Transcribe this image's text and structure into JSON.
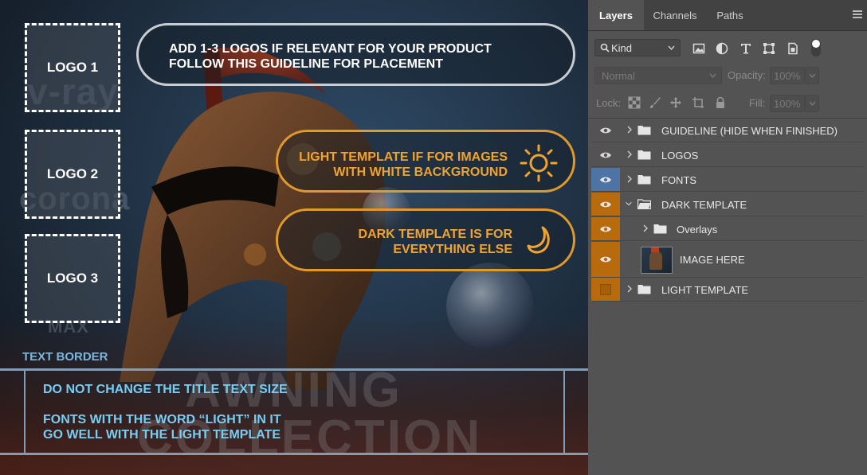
{
  "canvas": {
    "watermarks": {
      "vray": "v-ray",
      "corona": "corona",
      "max": "MAX"
    },
    "logos": [
      "LOGO 1",
      "LOGO 2",
      "LOGO 3"
    ],
    "guide_main": {
      "line1": "ADD 1-3 LOGOS IF RELEVANT FOR YOUR PRODUCT",
      "line2": "FOLLOW THIS GUIDELINE FOR PLACEMENT"
    },
    "guide_light": {
      "line1": "LIGHT TEMPLATE IF FOR IMAGES",
      "line2": "WITH WHITE BACKGROUND",
      "icon": "sun-icon"
    },
    "guide_dark": {
      "line1": "DARK TEMPLATE IS FOR",
      "line2": "EVERYTHING ELSE",
      "icon": "moon-icon"
    },
    "text_border_label": "TEXT BORDER",
    "notes": {
      "title_size": "DO NOT CHANGE THE TITLE TEXT SIZE",
      "fonts_line1": "FONTS WITH THE WORD “LIGHT” IN IT",
      "fonts_line2": "GO WELL WITH THE LIGHT TEMPLATE"
    },
    "title_watermark": {
      "line1": "AWNING",
      "line2": "COLLECTION"
    },
    "colors": {
      "accent_gold": "#f0a331",
      "note_blue": "#78cdf5",
      "label_blue": "#7ab6de"
    }
  },
  "layers_panel": {
    "tabs": [
      "Layers",
      "Channels",
      "Paths"
    ],
    "active_tab": "Layers",
    "filter_kind": "Kind",
    "blend_mode": "Normal",
    "opacity_label": "Opacity:",
    "opacity_value": "100%",
    "lock_label": "Lock:",
    "fill_label": "Fill:",
    "fill_value": "100%",
    "layers": [
      {
        "name": "GUIDELINE (HIDE WHEN FINISHED)",
        "type": "group",
        "visible": true,
        "expanded": false
      },
      {
        "name": "LOGOS",
        "type": "group",
        "visible": true,
        "expanded": false
      },
      {
        "name": "FONTS",
        "type": "group",
        "visible": true,
        "expanded": false,
        "color_tag": "blue"
      },
      {
        "name": "DARK TEMPLATE",
        "type": "group",
        "visible": true,
        "expanded": true,
        "color_tag": "orange"
      },
      {
        "name": "Overlays",
        "type": "group",
        "visible": true,
        "expanded": false,
        "color_tag": "orange"
      },
      {
        "name": "IMAGE HERE",
        "type": "image",
        "visible": true,
        "color_tag": "orange"
      },
      {
        "name": "LIGHT TEMPLATE",
        "type": "group",
        "visible": false,
        "expanded": false,
        "color_tag": "orange"
      }
    ],
    "colors": {
      "panel_bg": "#535353",
      "tag_orange": "#b76b0c",
      "tag_blue": "#4d74a5"
    }
  }
}
